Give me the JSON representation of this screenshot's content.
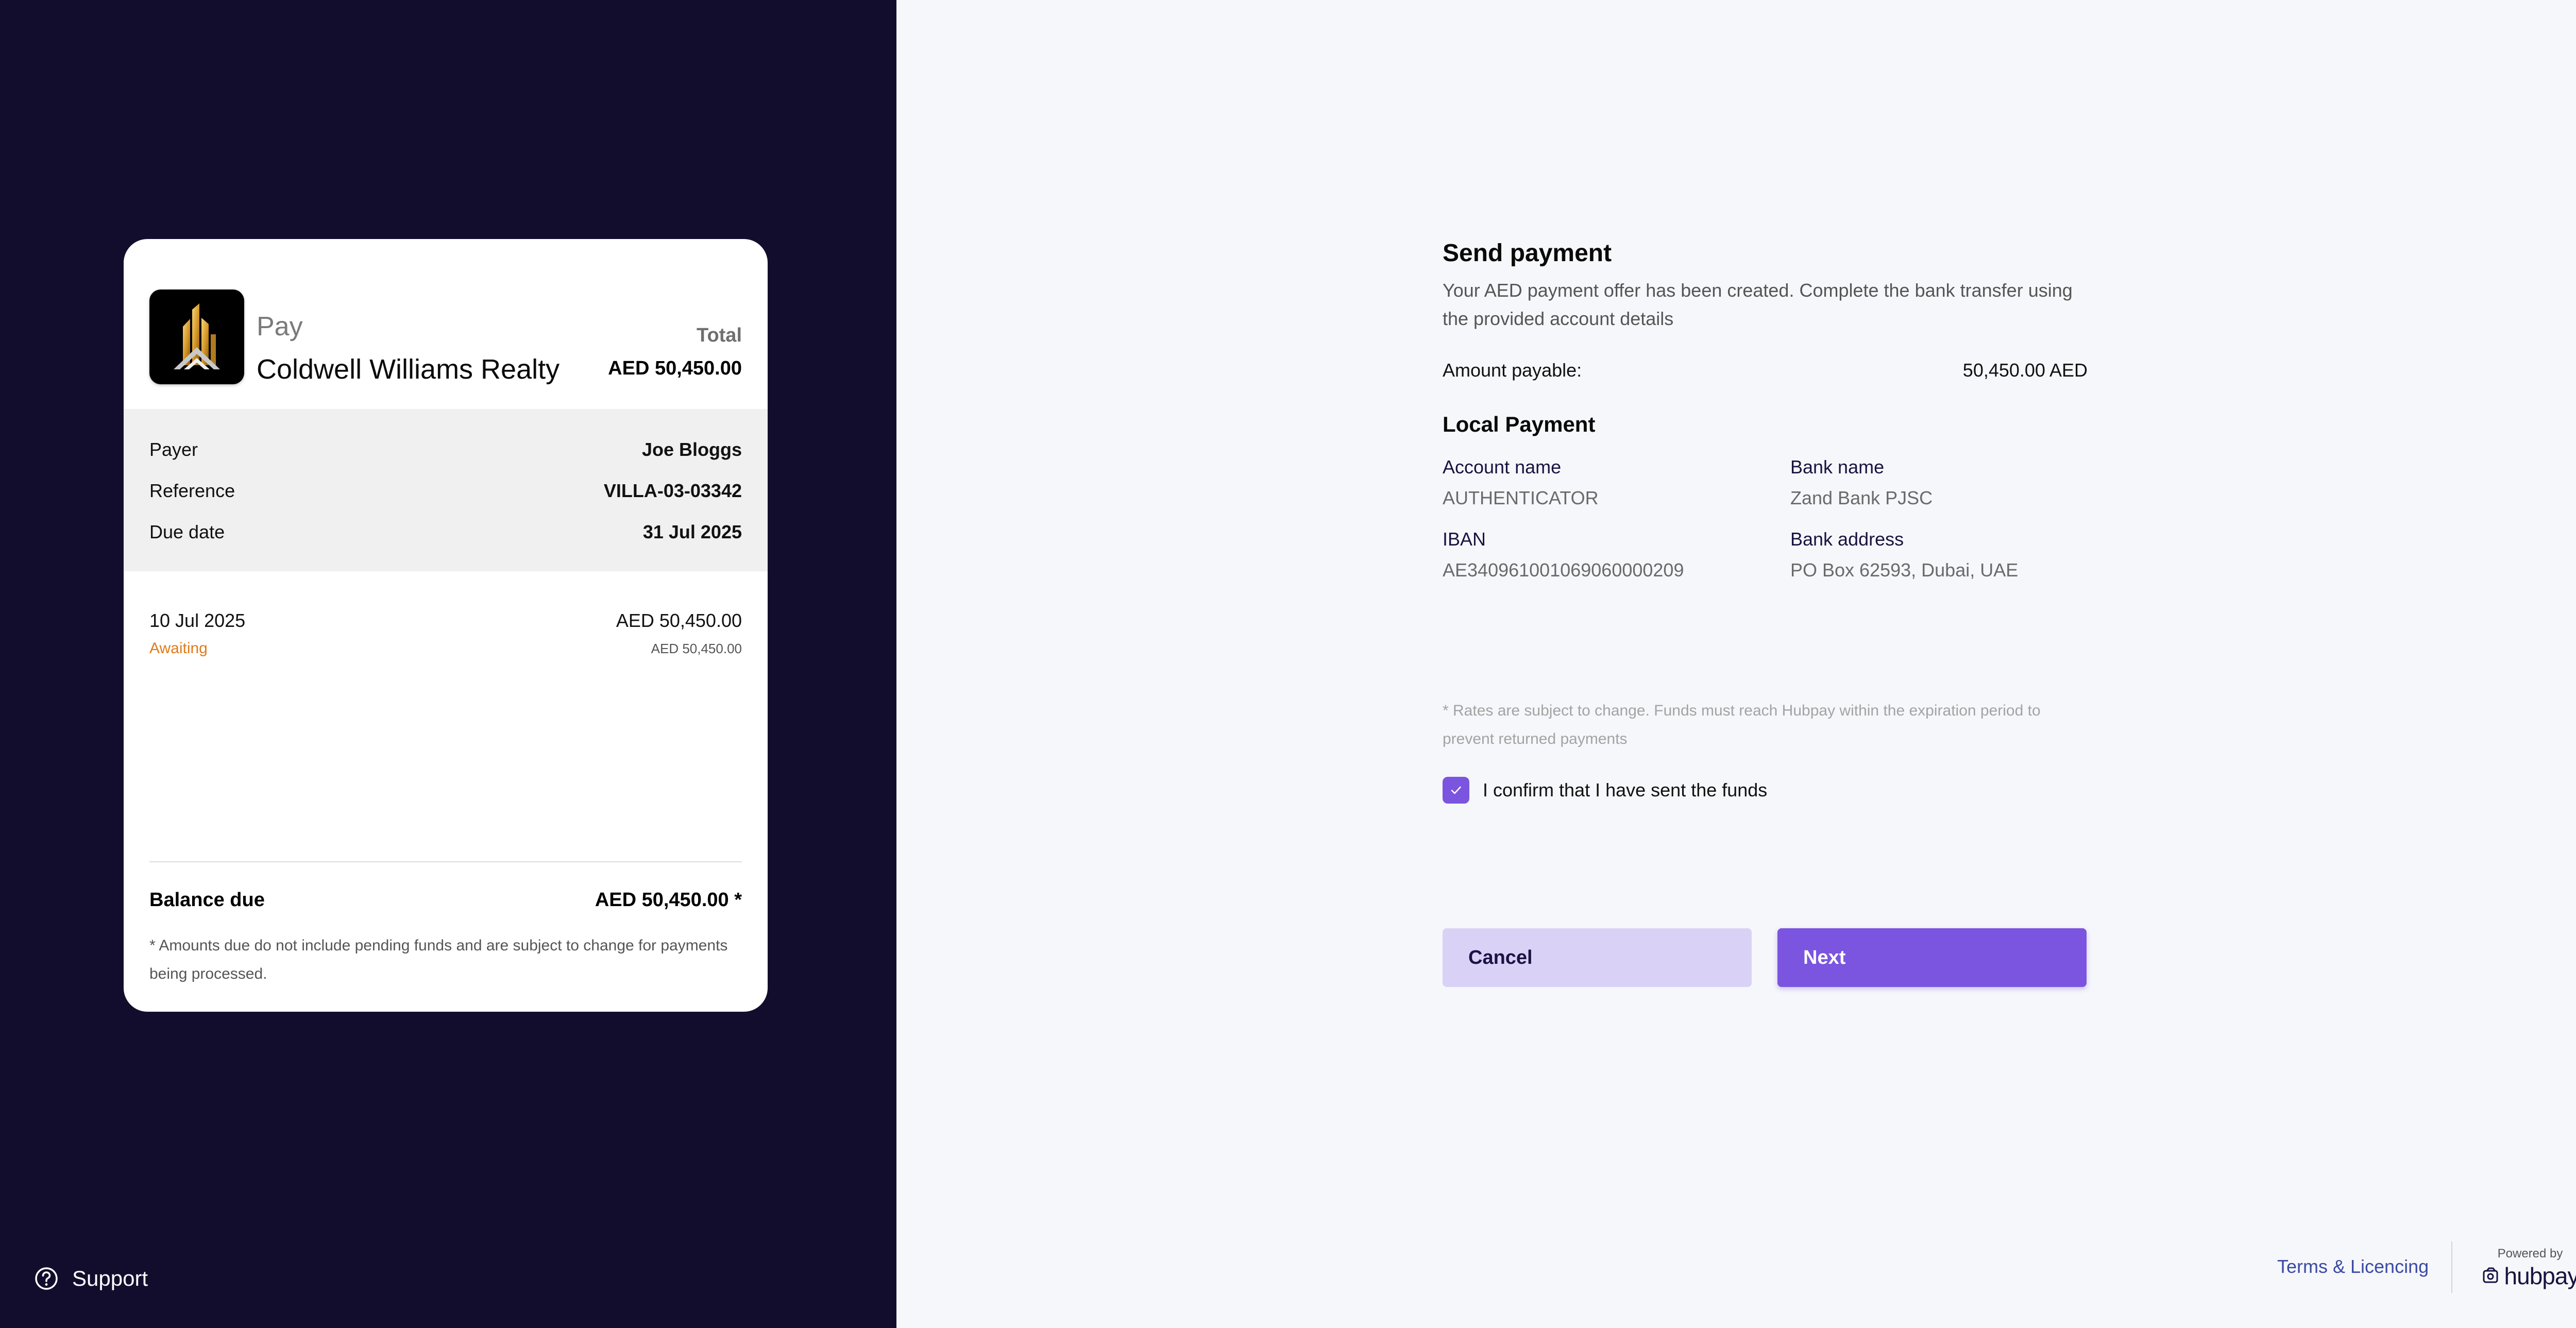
{
  "invoice": {
    "pay_label": "Pay",
    "merchant_name": "Coldwell Williams Realty",
    "total_label": "Total",
    "total_value": "AED 50,450.00",
    "details": [
      {
        "label": "Payer",
        "value": "Joe Bloggs"
      },
      {
        "label": "Reference",
        "value": "VILLA-03-03342"
      },
      {
        "label": "Due date",
        "value": "31 Jul 2025"
      }
    ],
    "payment_line": {
      "date": "10 Jul 2025",
      "status": "Awaiting",
      "amount": "AED 50,450.00",
      "sub_amount": "AED 50,450.00"
    },
    "balance_label": "Balance due",
    "balance_value": "AED 50,450.00 *",
    "balance_note": "* Amounts due do not include pending funds and are subject to change for payments being processed."
  },
  "support": {
    "label": "Support"
  },
  "payment": {
    "title": "Send payment",
    "subtitle": "Your AED payment offer has been created. Complete the bank transfer using the provided account details",
    "amount_label": "Amount payable:",
    "amount_value": "50,450.00 AED",
    "section_title": "Local Payment",
    "fields": {
      "account_name": {
        "label": "Account name",
        "value": "AUTHENTICATOR"
      },
      "bank_name": {
        "label": "Bank name",
        "value": "Zand Bank PJSC"
      },
      "iban": {
        "label": "IBAN",
        "value": "AE340961001069060000209"
      },
      "bank_address": {
        "label": "Bank address",
        "value": "PO Box 62593, Dubai, UAE"
      }
    },
    "disclaimer": "* Rates are subject to change. Funds must reach Hubpay within the expiration period to prevent returned payments",
    "confirm_text": "I confirm that I have sent the funds",
    "confirm_checked": true,
    "cancel_label": "Cancel",
    "next_label": "Next"
  },
  "footer": {
    "terms_label": "Terms & Licencing",
    "powered_by": "Powered by",
    "brand": "hubpay"
  },
  "colors": {
    "left_panel": "#130d2d",
    "accent": "#7b55df",
    "accent_light": "#d9d2f6",
    "awaiting": "#e07b1a",
    "link": "#3b4aa3"
  },
  "icons": {
    "logo": "gold-building-logo",
    "support": "help-circle-icon",
    "check": "check-icon",
    "brand": "hubpay-logo-icon"
  }
}
